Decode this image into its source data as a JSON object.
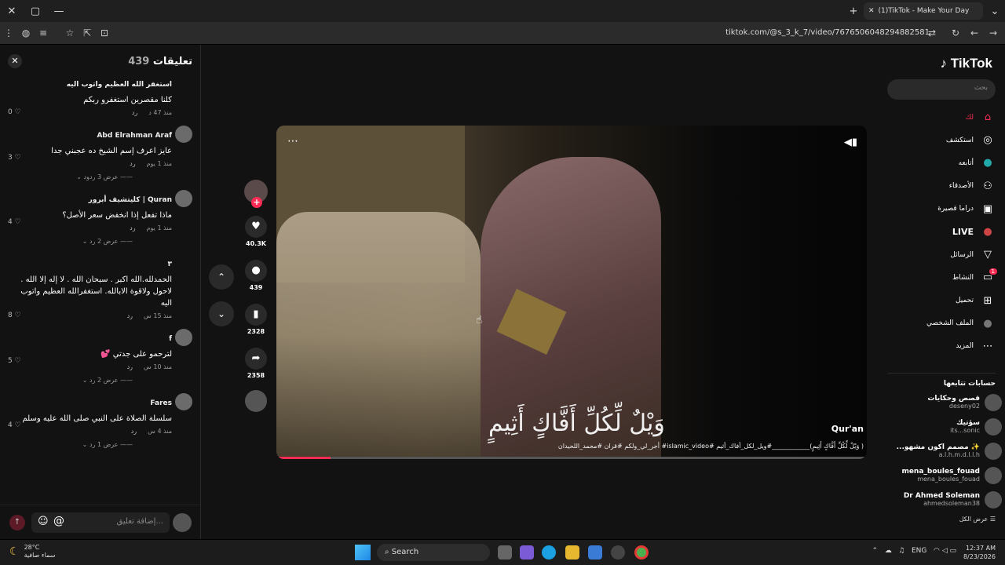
{
  "browser": {
    "tab_title": "(1)TikTok - Make Your Day",
    "url": "tiktok.com/@s_3_k_7/video/7676506048294882581"
  },
  "comments_panel": {
    "title": "تعليقات",
    "count": "439",
    "input_placeholder": "إضافة تعليق...",
    "items": [
      {
        "author": "استغفر الله العظيم واتوب اليه",
        "text": "كلنا مقصرين استغفرو ربكم",
        "time": "منذ 47 د",
        "reply": "رد",
        "likes": "0",
        "more": ""
      },
      {
        "author": "Abd Elrahman Araf",
        "text": "عايز اعرف إسم الشيخ ده عجبني جدا",
        "time": "منذ 1 يوم",
        "reply": "رد",
        "likes": "3",
        "more": "عرض 3 ردود"
      },
      {
        "author": "Quran | كليتشيف أبرور",
        "text": "ماذا تفعل إذا انخفض سعر الأصل؟",
        "time": "منذ 1 يوم",
        "reply": "رد",
        "likes": "4",
        "more": "عرض 2 رد"
      },
      {
        "author": "٣",
        "text": "الحمدلله.الله اكبر . سبحان الله . لا إله إلا الله . لاحول ولاقوة الابالله. استغفرالله العظيم واتوب اليه",
        "time": "منذ 15 س",
        "reply": "رد",
        "likes": "8",
        "more": ""
      },
      {
        "author": "f",
        "text": "لترحمو على جدتي 💕",
        "time": "منذ 10 س",
        "reply": "رد",
        "likes": "5",
        "more": "عرض 2 رد"
      },
      {
        "author": "Fares",
        "text": "سلسلة الصلاة على النبي صلى الله عليه وسلم",
        "time": "منذ 4 س",
        "reply": "رد",
        "likes": "4",
        "more": "عرض 1 رد"
      }
    ]
  },
  "video": {
    "overlay_text": "وَيْلٌ لِّكُلِّ أَفَّاكٍ أَثِيمٍ",
    "author": "Qur'an",
    "caption": "( وَيْلٌ لِّكُلِّ أَفَّاكٍ أَثِيمٍ)____________#ويل_لكل_أفاك_أثيم #islamic_video# أجر_لي_ولكم #قران #محمد_اللحيدان",
    "progress": 0.09
  },
  "actions": {
    "likes": "40.3K",
    "comments": "439",
    "saves": "2328",
    "shares": "2358"
  },
  "sidebar": {
    "logo": "TikTok",
    "search_placeholder": "بحث",
    "menu": [
      {
        "label": "لك",
        "icon": "home-icon",
        "glyph": "⌂"
      },
      {
        "label": "استكشف",
        "icon": "compass-icon",
        "glyph": "◎"
      },
      {
        "label": "أتابعه",
        "icon": "following-icon",
        "glyph": "●"
      },
      {
        "label": "الأصدقاء",
        "icon": "friends-icon",
        "glyph": "👥"
      },
      {
        "label": "دراما قصيرة",
        "icon": "drama-icon",
        "glyph": "▣"
      },
      {
        "label": "LIVE",
        "icon": "live-icon",
        "glyph": "●"
      },
      {
        "label": "الرسائل",
        "icon": "messages-icon",
        "glyph": "▽"
      },
      {
        "label": "النشاط",
        "icon": "activity-icon",
        "glyph": "▭"
      },
      {
        "label": "تحميل",
        "icon": "upload-icon",
        "glyph": "⊞"
      },
      {
        "label": "الملف الشخصي",
        "icon": "profile-icon",
        "glyph": "●"
      },
      {
        "label": "المزيد",
        "icon": "more-icon",
        "glyph": "⋯"
      }
    ],
    "activity_badge": "1",
    "following_title": "حسابات تتابعها",
    "following": [
      {
        "name": "قصص وحكايات",
        "handle": "deseny02"
      },
      {
        "name": "سؤتيك",
        "handle": "its...sonic"
      },
      {
        "name": "✨ مصمم اكون مشهو...",
        "handle": "a.l.h.m.d.l.l.h"
      },
      {
        "name": "mena_boules_fouad",
        "handle": "mena_boules_fouad"
      },
      {
        "name": "Dr Ahmed Soleman",
        "handle": "ahmedsoleman38"
      }
    ],
    "see_all": "عرض الكل"
  },
  "taskbar": {
    "temperature": "28°C",
    "weather": "سماء صافية",
    "search": "Search",
    "language": "ENG",
    "time": "12:37 AM",
    "date": "8/23/2026"
  }
}
